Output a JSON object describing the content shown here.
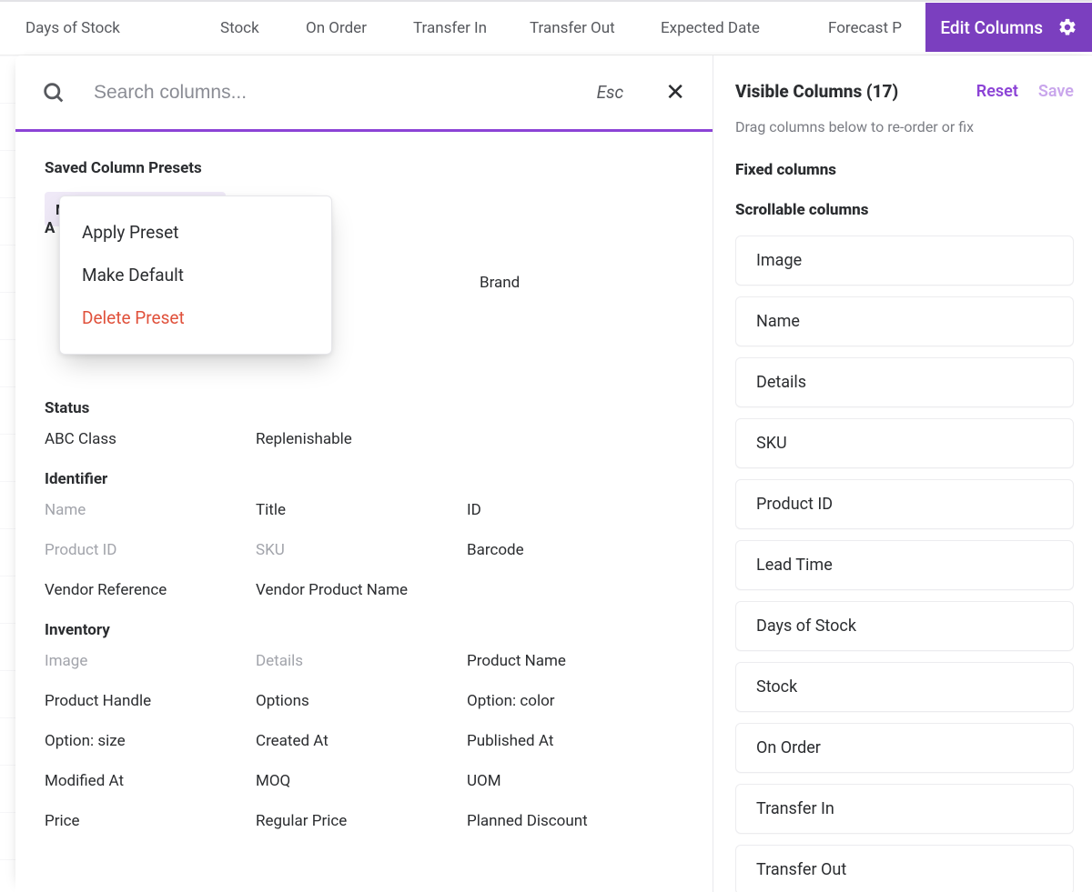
{
  "brand_accent": "#8c43d6",
  "header_columns": [
    "Days of Stock",
    "Stock",
    "On Order",
    "Transfer In",
    "Transfer Out",
    "Expected Date",
    "Forecast P"
  ],
  "edit_columns_button": "Edit Columns",
  "search": {
    "placeholder": "Search columns...",
    "esc_hint": "Esc"
  },
  "presets": {
    "section_title": "Saved Column Presets",
    "chip_label": "My Preset",
    "peek_letter": "A",
    "menu": {
      "apply": "Apply Preset",
      "make_default": "Make Default",
      "delete": "Delete Preset"
    }
  },
  "attribute_group": {
    "title_peek": "A",
    "brand_label": "Brand"
  },
  "groups": [
    {
      "title": "Status",
      "items": [
        {
          "label": "ABC Class",
          "muted": false
        },
        {
          "label": "Replenishable",
          "muted": false
        }
      ]
    },
    {
      "title": "Identifier",
      "items": [
        {
          "label": "Name",
          "muted": true
        },
        {
          "label": "Title",
          "muted": false
        },
        {
          "label": "ID",
          "muted": false
        },
        {
          "label": "Product ID",
          "muted": true
        },
        {
          "label": "SKU",
          "muted": true
        },
        {
          "label": "Barcode",
          "muted": false
        },
        {
          "label": "Vendor Reference",
          "muted": false
        },
        {
          "label": "Vendor Product Name",
          "muted": false
        }
      ]
    },
    {
      "title": "Inventory",
      "items": [
        {
          "label": "Image",
          "muted": true
        },
        {
          "label": "Details",
          "muted": true
        },
        {
          "label": "Product Name",
          "muted": false
        },
        {
          "label": "Product Handle",
          "muted": false
        },
        {
          "label": "Options",
          "muted": false
        },
        {
          "label": "Option: color",
          "muted": false
        },
        {
          "label": "Option: size",
          "muted": false
        },
        {
          "label": "Created At",
          "muted": false
        },
        {
          "label": "Published At",
          "muted": false
        },
        {
          "label": "Modified At",
          "muted": false
        },
        {
          "label": "MOQ",
          "muted": false
        },
        {
          "label": "UOM",
          "muted": false
        },
        {
          "label": "Price",
          "muted": false
        },
        {
          "label": "Regular Price",
          "muted": false
        },
        {
          "label": "Planned Discount",
          "muted": false
        }
      ]
    }
  ],
  "right": {
    "title": "Visible Columns (17)",
    "reset": "Reset",
    "save": "Save",
    "hint": "Drag columns below to re-order or fix",
    "fixed_label": "Fixed columns",
    "scrollable_label": "Scrollable columns",
    "scrollable_items": [
      "Image",
      "Name",
      "Details",
      "SKU",
      "Product ID",
      "Lead Time",
      "Days of Stock",
      "Stock",
      "On Order",
      "Transfer In",
      "Transfer Out"
    ]
  }
}
